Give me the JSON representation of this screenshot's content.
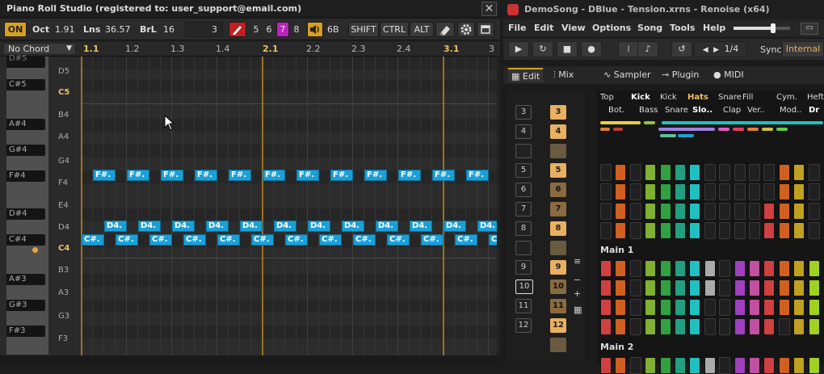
{
  "piano_roll": {
    "title": "Piano Roll Studio  (registered to: user_support@email.com)",
    "close": "✕",
    "toolbar": {
      "on": "ON",
      "oct_label": "Oct",
      "oct_value": "1.91",
      "lns_label": "Lns",
      "lns_value": "36.57",
      "brl_label": "BrL",
      "brl_value": "16",
      "num_value": "3",
      "voices": [
        "5",
        "6",
        "7",
        "8"
      ],
      "voice_selected": "7",
      "vol_value": "6B",
      "shift": "SHIFT",
      "ctrl": "CTRL",
      "alt": "ALT"
    },
    "chord": "No Chord",
    "bars": [
      "1.1",
      "1.2",
      "1.3",
      "1.4",
      "2.1",
      "2.2",
      "2.3",
      "2.4",
      "3.1",
      "3"
    ],
    "keys": {
      "black_labels": [
        "D#5",
        "C#5",
        "A#4",
        "G#4",
        "F#4",
        "D#4",
        "C#4",
        "A#3",
        "G#3",
        "F#3"
      ],
      "notes": [
        "D5",
        "C5",
        "B4",
        "A4",
        "G4",
        "F4",
        "E4",
        "D4",
        "C4",
        "B3",
        "A3",
        "G3",
        "F3"
      ]
    },
    "note_labels": {
      "fs4": "F#.",
      "d4": "D4.",
      "cs4": "C#."
    },
    "accent": "#1aa0d8"
  },
  "renoise": {
    "title": "DemoSong - DBlue - Tension.xrns - Renoise (x64)",
    "menu": [
      "File",
      "Edit",
      "View",
      "Options",
      "Song",
      "Tools",
      "Help"
    ],
    "transport": {
      "lpb": "1/4",
      "sync_label": "Sync",
      "sync_value": "Internal"
    },
    "tabs": [
      "Edit",
      "Mix",
      "Sampler",
      "Plugin",
      "MIDI"
    ],
    "patterns_left": [
      "3",
      "4",
      "",
      "5",
      "6",
      "7",
      "8",
      "",
      "9",
      "10",
      "11",
      "12"
    ],
    "patterns_right": [
      "3",
      "4",
      "",
      "5",
      "6",
      "7",
      "8",
      "",
      "9",
      "10",
      "11",
      "12",
      ""
    ],
    "track_headers_row1": [
      "Top",
      "Kick",
      "Kick",
      "Hats",
      "Snare",
      "Fill",
      "Cym.",
      "Heft"
    ],
    "track_headers_row2": [
      "Bot.",
      "Bass",
      "Snare",
      "Slo..",
      "Clap",
      "Ver..",
      "Mod..",
      "Dr"
    ],
    "sections": [
      "Main 1",
      "Main 2"
    ]
  }
}
